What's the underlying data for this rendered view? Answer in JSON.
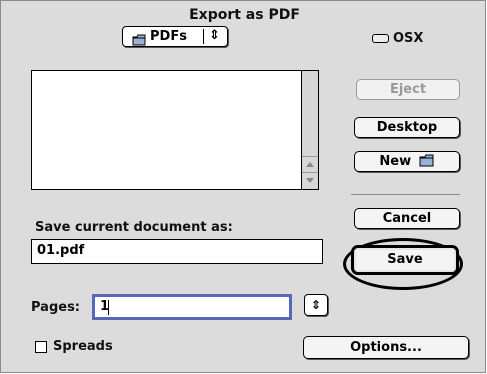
{
  "dialog": {
    "title": "Export as PDF",
    "folder_popup": {
      "selected": "PDFs",
      "arrows": "⇕",
      "icon": "folder-icon"
    },
    "disk": {
      "label": "OSX",
      "icon": "disk-icon"
    },
    "buttons": {
      "eject": "Eject",
      "desktop": "Desktop",
      "new": "New",
      "cancel": "Cancel",
      "save": "Save",
      "options": "Options..."
    },
    "save_as_label": "Save current document as:",
    "filename": "01.pdf",
    "pages_label": "Pages:",
    "pages_value": "1",
    "pages_stepper": "⇕",
    "spreads_label": "Spreads",
    "spreads_checked": false
  }
}
